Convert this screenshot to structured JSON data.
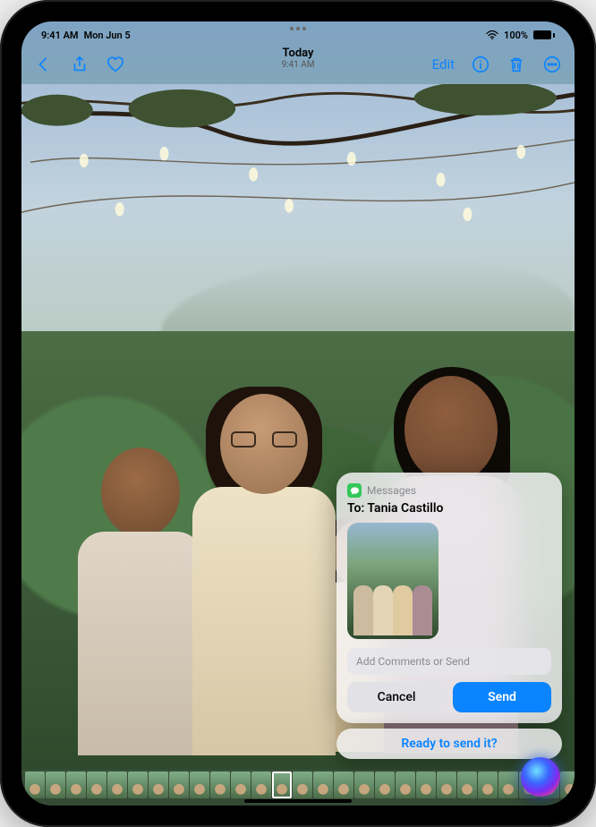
{
  "status": {
    "time": "9:41 AM",
    "date": "Mon Jun 5",
    "battery_pct": "100%"
  },
  "nav": {
    "title": "Today",
    "subtitle": "9:41 AM",
    "edit_label": "Edit"
  },
  "siri": {
    "app_label": "Messages",
    "to_prefix": "To:",
    "recipient": "Tania Castillo",
    "input_placeholder": "Add Comments or Send",
    "cancel_label": "Cancel",
    "send_label": "Send",
    "confirm_text": "Ready to send it?"
  }
}
